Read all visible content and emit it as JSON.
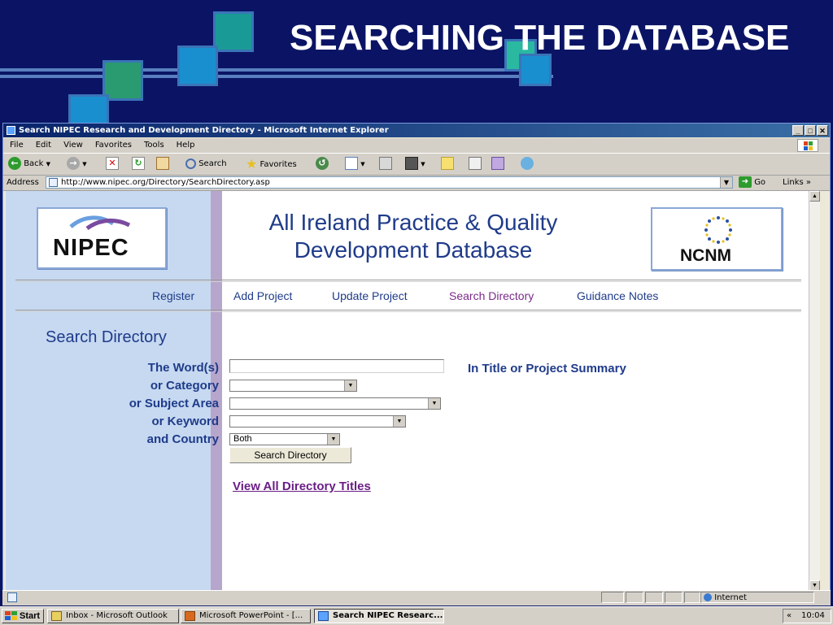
{
  "slide": {
    "title": "SEARCHING THE DATABASE"
  },
  "window": {
    "title": "Search NIPEC Research and Development Directory - Microsoft Internet Explorer",
    "buttons": [
      "_",
      "□",
      "✕"
    ]
  },
  "menu": [
    "File",
    "Edit",
    "View",
    "Favorites",
    "Tools",
    "Help"
  ],
  "toolbar": {
    "back": "Back",
    "search": "Search",
    "favorites": "Favorites"
  },
  "address": {
    "label": "Address",
    "url": "http://www.nipec.org/Directory/SearchDirectory.asp",
    "go": "Go",
    "links": "Links"
  },
  "page": {
    "logo_left": "NIPEC",
    "logo_right": "NCNM",
    "title_line1": "All Ireland Practice & Quality",
    "title_line2": "Development Database",
    "nav": [
      {
        "label": "Register",
        "active": false
      },
      {
        "label": "Add Project",
        "active": false
      },
      {
        "label": "Update Project",
        "active": false
      },
      {
        "label": "Search Directory",
        "active": true
      },
      {
        "label": "Guidance Notes",
        "active": false
      }
    ],
    "heading": "Search Directory",
    "form": {
      "words_label": "The Word(s)",
      "category_label": "or Category",
      "subject_label": "or Subject Area",
      "keyword_label": "or Keyword",
      "country_label": "and Country",
      "words_value": "",
      "in_title": "In Title or Project Summary",
      "category_value": "",
      "subject_value": "",
      "keyword_value": "",
      "country_value": "Both",
      "search_button": "Search Directory"
    },
    "view_all": "View All Directory Titles"
  },
  "status": {
    "zone": "Internet"
  },
  "taskbar": {
    "start": "Start",
    "tasks": [
      {
        "label": "Inbox - Microsoft Outlook",
        "pressed": false
      },
      {
        "label": "Microsoft PowerPoint - [...",
        "pressed": false
      },
      {
        "label": "Search NIPEC Researc...",
        "pressed": true
      }
    ],
    "clock": "10:04"
  },
  "colors": {
    "slide_bg": "#0b1464",
    "link_blue": "#1f3b8a",
    "link_purple": "#6b1d86",
    "left_panel": "#c6d9f1"
  }
}
